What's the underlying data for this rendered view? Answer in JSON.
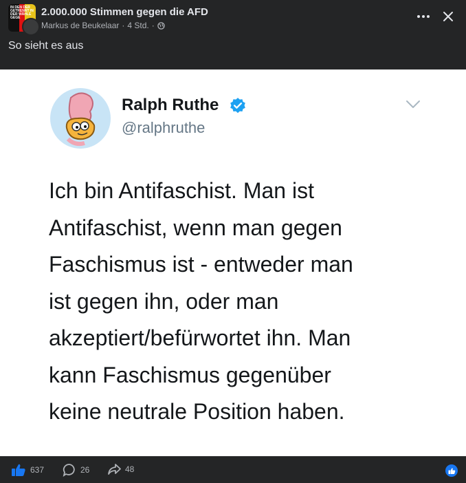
{
  "post": {
    "group_name": "2.000.000 Stimmen gegen die AFD",
    "author": "Markus de Beukelaar",
    "separator": "·",
    "time": "4 Std.",
    "text": "So sieht es aus",
    "group_avatar_text": "IN DEN DER GETRENNT IN DER WÄHLE GEGE"
  },
  "tweet": {
    "name": "Ralph Ruthe",
    "handle": "@ralphruthe",
    "body": "Ich bin Antifaschist. Man ist\nAntifaschist, wenn man gegen\nFaschismus ist - entweder man\nist gegen ihn, oder man\nakzeptiert/befürwortet ihn. Man\nkann Faschismus gegenüber\nkeine neutrale Position haben."
  },
  "footer": {
    "likes": "637",
    "comments": "26",
    "shares": "48"
  },
  "colors": {
    "background": "#242526",
    "accent": "#1877f2",
    "verified": "#1da1f2"
  }
}
